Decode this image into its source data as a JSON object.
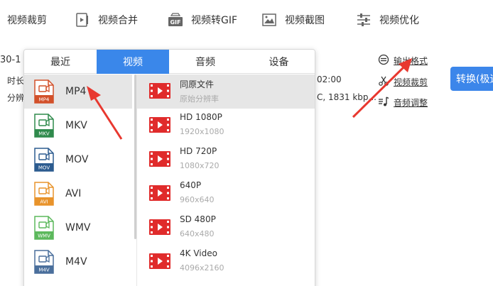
{
  "toolbar": {
    "items": [
      {
        "label": "视频裁剪",
        "icon": "crop-icon"
      },
      {
        "label": "视频合并",
        "icon": "video-merge-icon"
      },
      {
        "label": "视频转GIF",
        "icon": "gif-icon"
      },
      {
        "label": "视频截图",
        "icon": "screenshot-icon"
      },
      {
        "label": "视频优化",
        "icon": "optimize-icon"
      }
    ]
  },
  "background": {
    "file_name_fragment": "30-1",
    "duration_label_fragment": "时长",
    "resolution_label_fragment": "分辨",
    "duration_value_fragment": "02:00",
    "codec_fragment": "C, 1831 kbp..."
  },
  "right_panel": {
    "output_format": "输出格式",
    "video_crop": "视频裁剪",
    "audio_adjust": "音频调整",
    "convert_button": "转换(极速"
  },
  "popup": {
    "tabs": [
      "最近",
      "视频",
      "音频",
      "设备"
    ],
    "active_tab": "视频",
    "formats": [
      {
        "label": "MP4",
        "badge": "MP4",
        "color": "#d2502a",
        "selected": true
      },
      {
        "label": "MKV",
        "badge": "MKV",
        "color": "#2f8a4c",
        "selected": false
      },
      {
        "label": "MOV",
        "badge": "MOV",
        "color": "#2c5b8f",
        "selected": false
      },
      {
        "label": "AVI",
        "badge": "AVI",
        "color": "#e8932b",
        "selected": false
      },
      {
        "label": "WMV",
        "badge": "WMV",
        "color": "#5cb85c",
        "selected": false
      },
      {
        "label": "M4V",
        "badge": "M4V",
        "color": "#4a6f9c",
        "selected": false
      }
    ],
    "qualities": [
      {
        "name": "同原文件",
        "sub": "原始分辨率",
        "selected": true
      },
      {
        "name": "HD 1080P",
        "sub": "1920x1080",
        "selected": false
      },
      {
        "name": "HD 720P",
        "sub": "1080x720",
        "selected": false
      },
      {
        "name": "640P",
        "sub": "960x640",
        "selected": false
      },
      {
        "name": "SD 480P",
        "sub": "640x480",
        "selected": false
      },
      {
        "name": "4K Video",
        "sub": "4096x2160",
        "selected": false
      }
    ]
  },
  "colors": {
    "accent": "#3a87ea",
    "arrow": "#e8382f",
    "film_icon": "#e02b2b"
  }
}
